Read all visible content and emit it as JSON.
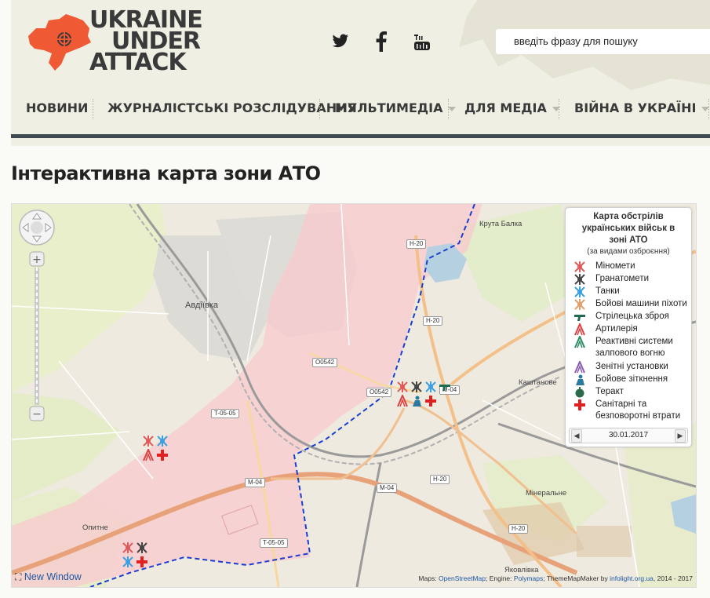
{
  "site": {
    "logo_line1": "UKRAINE",
    "logo_line2": "UNDER",
    "logo_line3": "ATTACK",
    "logo_map_color": "#ef5a35"
  },
  "social": [
    "twitter-icon",
    "facebook-icon",
    "youtube-icon"
  ],
  "search": {
    "placeholder": "введіть фразу для пошуку"
  },
  "nav": {
    "items": [
      {
        "label": "НОВИНИ",
        "dropdown": false
      },
      {
        "label": "ЖУРНАЛІСТСЬКІ РОЗСЛІДУВАННЯ",
        "dropdown": false
      },
      {
        "label": "МУЛЬТИМЕДІА",
        "dropdown": true
      },
      {
        "label": "ДЛЯ МЕДІА",
        "dropdown": true
      },
      {
        "label": "ВІЙНА В УКРАЇНІ",
        "dropdown": true
      }
    ]
  },
  "page_title": "Інтерактивна карта зони АТО",
  "map": {
    "place_labels": [
      "Авдіївка",
      "Крута Балка",
      "Каштанове",
      "Мінеральне",
      "Опитне",
      "Яковлівка"
    ],
    "road_labels": [
      "H-20",
      "H-20",
      "O0542",
      "O0542",
      "M-04",
      "T-05-05",
      "M-04",
      "M-04",
      "H-20",
      "H-20",
      "T-05-05"
    ],
    "front_line_color": "#1a3fd0",
    "occupied_area_color": "#f8c9cf",
    "legend": {
      "title": "Карта обстрілів українських військ в зоні АТО",
      "subtitle": "(за видами озброєння)",
      "items": [
        {
          "label": "Міномети",
          "icon": "mortar-icon",
          "color": "#e05a5a"
        },
        {
          "label": "Гранатомети",
          "icon": "grenade-launcher-icon",
          "color": "#444444"
        },
        {
          "label": "Танки",
          "icon": "tank-icon",
          "color": "#3aa0e0"
        },
        {
          "label": "Бойові машини піхоти",
          "icon": "ifv-icon",
          "color": "#e0a070"
        },
        {
          "label": "Стрілецька зброя",
          "icon": "small-arms-icon",
          "color": "#1f6b4f"
        },
        {
          "label": "Артилерія",
          "icon": "artillery-icon",
          "color": "#d94040"
        },
        {
          "label": "Реактивні системи залпового вогню",
          "icon": "mlrs-icon",
          "color": "#2a8a60"
        },
        {
          "label": "Зенітні установки",
          "icon": "anti-aircraft-icon",
          "color": "#8a5ab0"
        },
        {
          "label": "Бойове зіткнення",
          "icon": "combat-clash-icon",
          "color": "#2a7aa0"
        },
        {
          "label": "Теракт",
          "icon": "terror-attack-icon",
          "color": "#2a6a4a"
        },
        {
          "label": "Санітарні та безповоротні втрати",
          "icon": "casualties-icon",
          "color": "#e02020"
        }
      ],
      "date": "30.01.2017"
    },
    "new_window_label": "New Window",
    "attribution": {
      "prefix": "Maps:",
      "maps_link": "OpenStreetMap",
      "engine_prefix": "; Engine:",
      "engine_link": "Polymaps",
      "tmm_text": "; ThemeMapMaker by",
      "tmm_link": "infolight.org.ua",
      "years": ", 2014 - 2017"
    }
  }
}
